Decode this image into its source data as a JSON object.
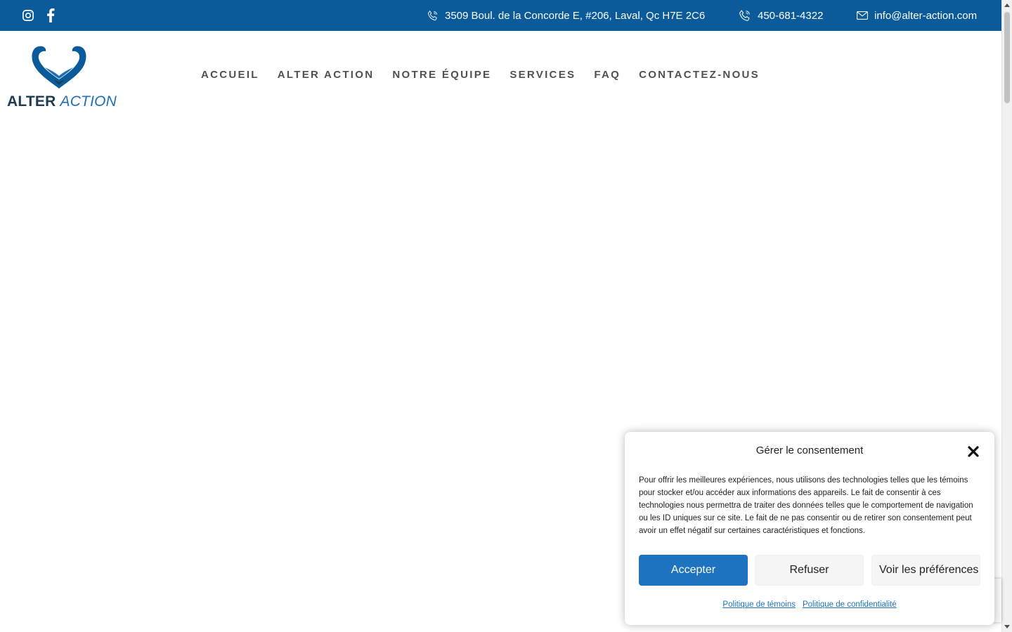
{
  "topbar": {
    "bg_color": "#0b5b9b",
    "social": [
      {
        "icon": "instagram-icon"
      },
      {
        "icon": "facebook-icon"
      }
    ],
    "address": "3509 Boul. de la Concorde E, #206, Laval, Qc H7E 2C6",
    "phone": "450-681-4322",
    "email": "info@alter-action.com"
  },
  "logo": {
    "word1": "ALTER",
    "word2": "ACTION",
    "brand_color": "#1f6fb4"
  },
  "nav": {
    "items": [
      "ACCUEIL",
      "ALTER ACTION",
      "NOTRE ÉQUIPE",
      "SERVICES",
      "FAQ",
      "CONTACTEZ-NOUS"
    ]
  },
  "consent": {
    "title": "Gérer le consentement",
    "text": "Pour offrir les meilleures expériences, nous utilisons des technologies telles que les témoins pour stocker et/ou accéder aux informations des appareils. Le fait de consentir à ces technologies nous permettra de traiter des données telles que le comportement de navigation ou les ID uniques sur ce site. Le fait de ne pas consentir ou de retirer son consentement peut avoir un effet négatif sur certaines caractéristiques et fonctions.",
    "accept_label": "Accepter",
    "refuse_label": "Refuser",
    "prefs_label": "Voir les préférences",
    "link_cookies": "Politique de témoins",
    "link_privacy": "Politique de confidentialité",
    "accent_color": "#1e73be"
  }
}
